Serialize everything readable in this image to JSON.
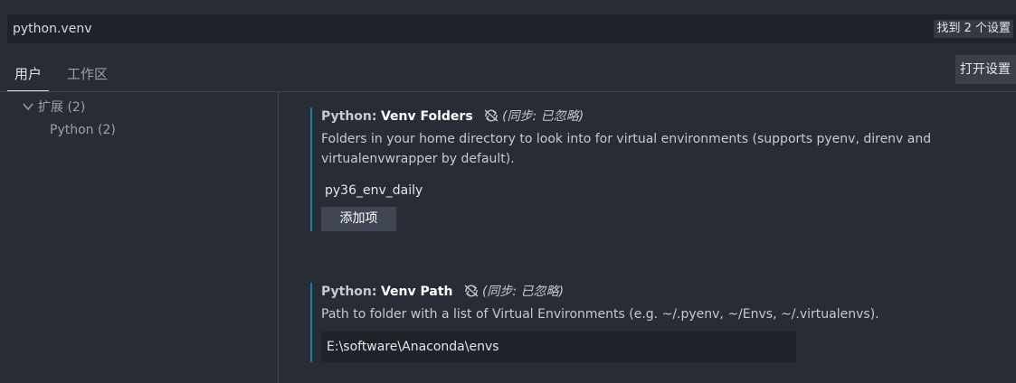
{
  "search": {
    "value": "python.venv",
    "result_count": "找到 2 个设置"
  },
  "tabs": [
    {
      "label": "用户",
      "active": true
    },
    {
      "label": "工作区",
      "active": false
    }
  ],
  "open_settings_label": "打开设置",
  "toc": {
    "items": [
      {
        "label": "扩展 (2)",
        "expanded": true,
        "icon": "chevron-down-icon"
      },
      {
        "label": "Python (2)"
      }
    ]
  },
  "settings": [
    {
      "category": "Python:",
      "name": "Venv Folders",
      "sync_label": "同步: 已忽略",
      "description": "Folders in your home directory to look into for virtual environments (supports pyenv, direnv and virtualenvwrapper by default).",
      "list_items": [
        "py36_env_daily"
      ],
      "add_button": "添加项"
    },
    {
      "category": "Python:",
      "name": "Venv Path",
      "sync_label": "同步: 已忽略",
      "description": "Path to folder with a list of Virtual Environments (e.g. ~/.pyenv, ~/Envs, ~/.virtualenvs).",
      "value": "E:\\software\\Anaconda\\envs"
    }
  ],
  "colors": {
    "accent_border": "#0e7fa6",
    "background": "#282c34",
    "input_background": "#1f2228"
  }
}
